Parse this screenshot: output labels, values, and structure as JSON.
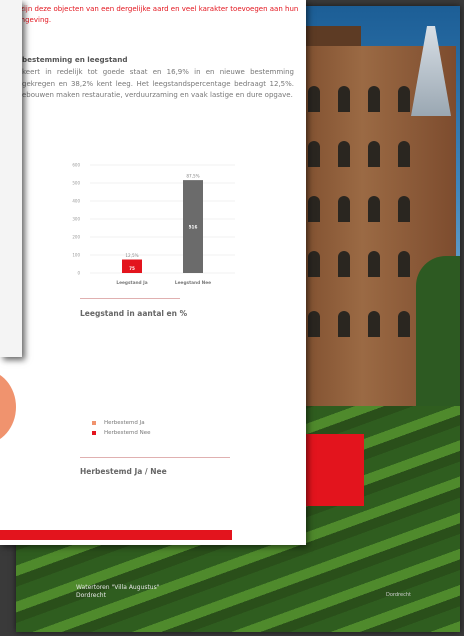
{
  "intro_text": "k zijn deze objecten van een dergelijke aard en veel karakter toevoegen aan hun omgeving.",
  "section": {
    "heading": "bestemming en leegstand",
    "body": "keert in redelijk tot goede staat en 16,9% in en nieuwe bestemming gekregen en 38,2% kent leeg. Het leegstandspercentage bedraagt 12,5%. ebouwen maken restauratie, verduurzaming en vaak lastige en dure opgave."
  },
  "chart_data": {
    "type": "bar",
    "title": "Leegstand in aantal en %",
    "categories": [
      "Leegstand Ja",
      "Leegstand Nee"
    ],
    "values": [
      75,
      516
    ],
    "percent_labels": [
      "12,5%",
      "87,5%"
    ],
    "ylim": [
      0,
      600
    ],
    "yticks": [
      0,
      100,
      200,
      300,
      400,
      500,
      600
    ],
    "colors": [
      "#e3141d",
      "#6b6b6b"
    ],
    "grid": true
  },
  "pie_chart": {
    "title": "Herbestemd Ja / Nee",
    "legend": [
      {
        "label": "Herbestemd Ja",
        "color": "#f0936e"
      },
      {
        "label": "Herbestemd Nee",
        "color": "#e3141d"
      }
    ]
  },
  "photo": {
    "caption_line1": "Watertoren \"Villa Augustus\"",
    "caption_line2": "Dordrecht",
    "page_tag": "Dordrecht"
  }
}
